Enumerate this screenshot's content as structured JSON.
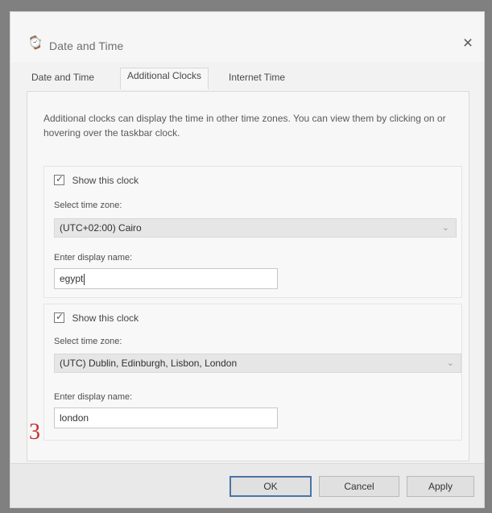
{
  "window": {
    "title": "Date and Time",
    "close_icon": "×"
  },
  "tabs": [
    {
      "label": "Date and Time",
      "active": false
    },
    {
      "label": "Additional Clocks",
      "active": true
    },
    {
      "label": "Internet Time",
      "active": false
    }
  ],
  "description": "Additional clocks can display the time in other time zones. You can view them by clicking on or hovering over the taskbar clock.",
  "clocks": [
    {
      "show_label": "Show this clock",
      "checked": true,
      "zone_label": "Select time zone:",
      "zone_value": "(UTC+02:00) Cairo",
      "name_label": "Enter display name:",
      "name_value": "egypt"
    },
    {
      "show_label": "Show this clock",
      "checked": true,
      "zone_label": "Select time zone:",
      "zone_value": "(UTC) Dublin, Edinburgh, Lisbon, London",
      "name_label": "Enter display name:",
      "name_value": "london"
    }
  ],
  "annotation": {
    "number": "3",
    "color": "#c82f2f"
  },
  "buttons": {
    "ok": "OK",
    "cancel": "Cancel",
    "apply": "Apply"
  },
  "icons": {
    "app": "clock-icon",
    "close": "close-icon",
    "dropdown": "chevron-down-icon",
    "check": "check-icon"
  }
}
